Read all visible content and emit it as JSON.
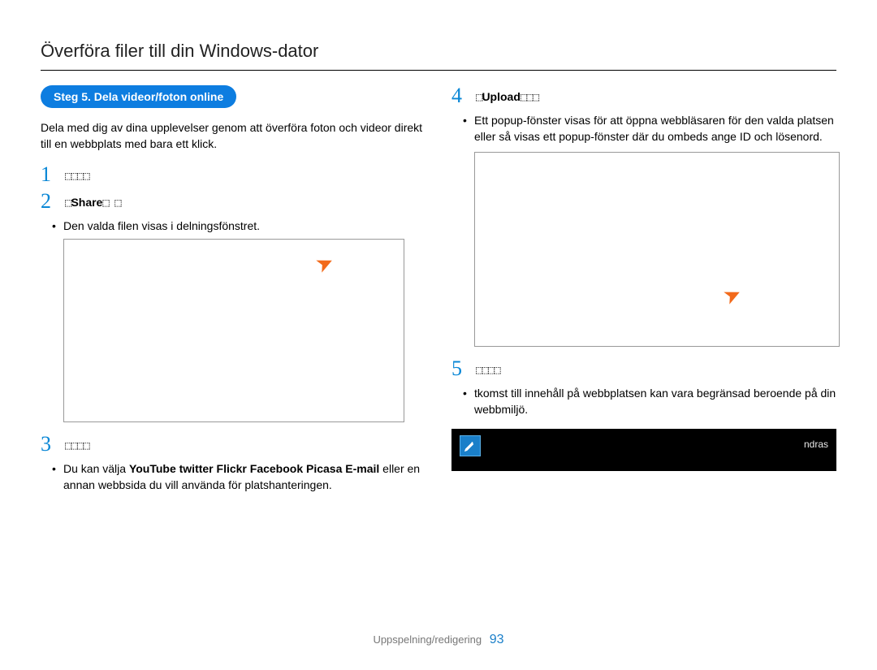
{
  "page_title": "Överföra filer till din Windows-dator",
  "step_badge": "Steg 5. Dela videor/foton online",
  "intro": "Dela med dig av dina upplevelser genom att överföra foton och videor direkt till en webbplats med bara ett klick.",
  "left": {
    "n1": "1",
    "head1_glyph": "⬚⬚⬚⬚",
    "n2": "2",
    "head2_prefix": "⬚",
    "head2_bold": "Share",
    "head2_glyph": "⬚                    ⬚",
    "bullet2": "Den valda filen visas i delningsfönstret.",
    "n3": "3",
    "head3_glyph": "⬚⬚⬚⬚",
    "bullet3_pre": "Du kan välja ",
    "bullet3_bold": "YouTube twitter Flickr Facebook Picasa E-mail",
    "bullet3_post": " eller en annan webbsida du vill använda för platshanteringen."
  },
  "right": {
    "n4": "4",
    "head4_prefix": "⬚",
    "head4_bold": "Upload",
    "head4_glyph": "⬚⬚⬚",
    "bullet4": "Ett popup-fönster visas för att öppna webbläsaren för den valda platsen eller så visas ett popup-fönster där du ombeds ange ID och lösenord.",
    "n5": "5",
    "head5_glyph": "⬚⬚⬚⬚",
    "bullet5": "tkomst till innehåll på webbplatsen kan vara begränsad beroende på din webbmiljö.",
    "note_trail": "ndras"
  },
  "footer_label": "Uppspelning/redigering",
  "page_number": "93"
}
